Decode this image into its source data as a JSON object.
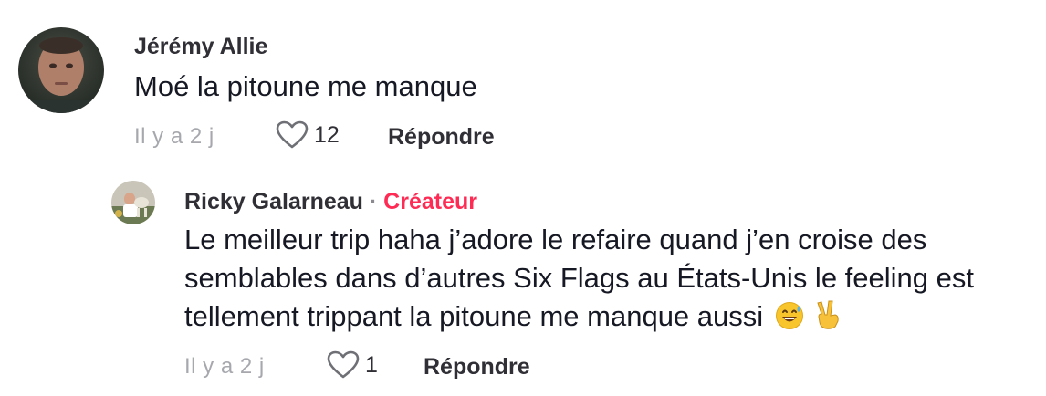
{
  "comments": [
    {
      "username": "Jérémy Allie",
      "text": "Moé la pitoune me manque",
      "time": "Il y a 2 j",
      "likes": "12",
      "reply_label": "Répondre"
    }
  ],
  "reply": {
    "username": "Ricky Galarneau",
    "separator": "·",
    "badge": "Créateur",
    "text_lines": [
      "Le meilleur trip haha j’adore le refaire quand j’en croise des",
      "semblables dans d’autres Six Flags au États-Unis le feeling est",
      "tellement trippant la pitoune me manque aussi"
    ],
    "emojis": [
      "grinning-sweat-emoji",
      "victory-hand-emoji"
    ],
    "time": "Il y a 2 j",
    "likes": "1",
    "reply_label": "Répondre"
  },
  "colors": {
    "accent_creator": "#fe2c55",
    "meta_gray": "#a7a8ad",
    "text": "#161823"
  }
}
